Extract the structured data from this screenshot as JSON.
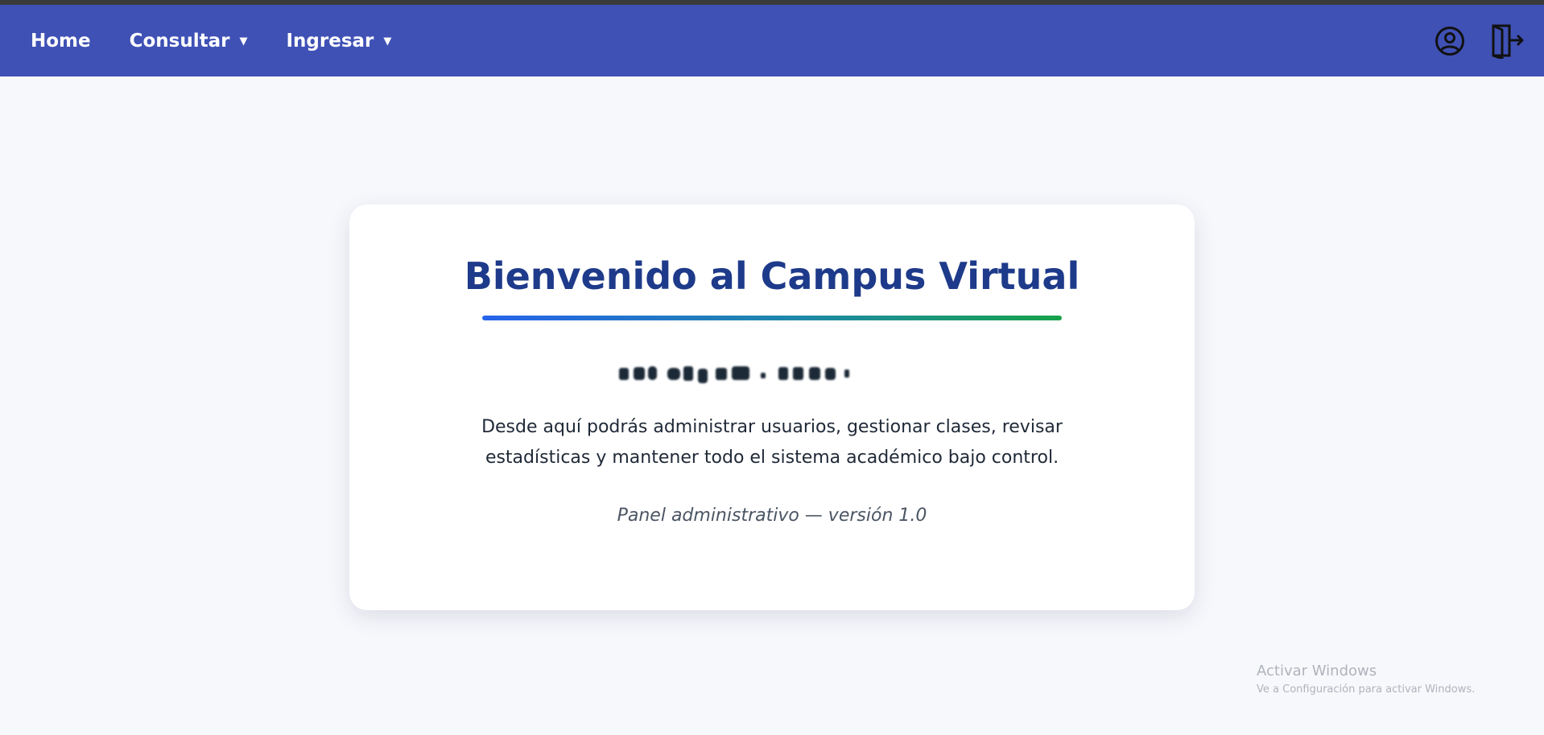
{
  "nav": {
    "items": [
      {
        "label": "Home"
      },
      {
        "label": "Consultar",
        "dropdown": true
      },
      {
        "label": "Ingresar",
        "dropdown": true
      }
    ],
    "icons": {
      "user": "user-circle-icon",
      "logout": "logout-door-icon"
    },
    "background_color": "#3f51b5"
  },
  "card": {
    "title": "Bienvenido al Campus Virtual",
    "description": "Desde aquí podrás administrar usuarios, gestionar clases, revisar estadísticas y mantener todo el sistema académico bajo control.",
    "version": "Panel administrativo — versión 1.0",
    "title_color": "#1e3a8a",
    "underline_gradient": [
      "#2563eb",
      "#16a34a"
    ]
  },
  "watermark": {
    "title": "Activar Windows",
    "subtitle": "Ve a Configuración para activar Windows."
  }
}
